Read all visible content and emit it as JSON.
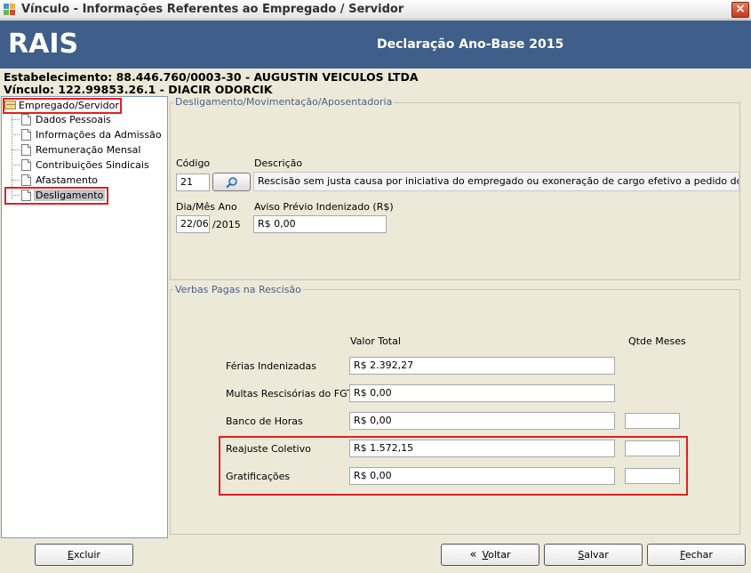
{
  "window": {
    "title": "Vínculo - Informações Referentes ao Empregado / Servidor",
    "close_label": "×"
  },
  "banner": {
    "logo": "RAIS",
    "title": "Declaração Ano-Base 2015",
    "color": "#3f5f8a"
  },
  "header": {
    "estabelecimento": "Estabelecimento: 88.446.760/0003-30 - AUGUSTIN VEICULOS LTDA",
    "vinculo": "Vínculo: 122.99853.26.1 - DIACIR ODORCIK"
  },
  "tree": {
    "root": "Empregado/Servidor",
    "items": [
      {
        "label": "Dados Pessoais"
      },
      {
        "label": "Informações da Admissão"
      },
      {
        "label": "Remuneração Mensal"
      },
      {
        "label": "Contribuições Sindicais"
      },
      {
        "label": "Afastamento"
      },
      {
        "label": "Desligamento",
        "selected": true
      }
    ]
  },
  "desligamento": {
    "legend": "Desligamento/Movimentação/Aposentadoria",
    "codigo_label": "Código",
    "codigo_value": "21",
    "descricao_label": "Descrição",
    "descricao_value": "Rescisão sem justa causa por iniciativa do empregado ou exoneração de cargo efetivo a pedido do servidor.",
    "diames_label": "Dia/Mês Ano",
    "diames_value": "22/06",
    "ano_value": "/2015",
    "aviso_label": "Aviso Prévio Indenizado (R$)",
    "aviso_value": "R$ 0,00"
  },
  "verbas": {
    "legend": "Verbas Pagas na Rescisão",
    "col_valor": "Valor Total",
    "col_qtde": "Qtde Meses",
    "rows": [
      {
        "label": "Férias Indenizadas",
        "value": "R$ 2.392,27",
        "qtde": null
      },
      {
        "label": "Multas Rescisórias do FGTS",
        "value": "R$ 0,00",
        "qtde": null
      },
      {
        "label": "Banco de Horas",
        "value": "R$ 0,00",
        "qtde": ""
      },
      {
        "label": "Reajuste Coletivo",
        "value": "R$ 1.572,15",
        "qtde": ""
      },
      {
        "label": "Gratificações",
        "value": "R$ 0,00",
        "qtde": ""
      }
    ]
  },
  "buttons": {
    "excluir": {
      "first": "E",
      "rest": "xcluir"
    },
    "voltar": {
      "first": "V",
      "rest": "oltar"
    },
    "salvar": {
      "first": "S",
      "rest": "alvar"
    },
    "fechar": {
      "first": "F",
      "rest": "echar"
    }
  },
  "colors": {
    "highlight": "#e02020",
    "legend": "#4a6287"
  }
}
